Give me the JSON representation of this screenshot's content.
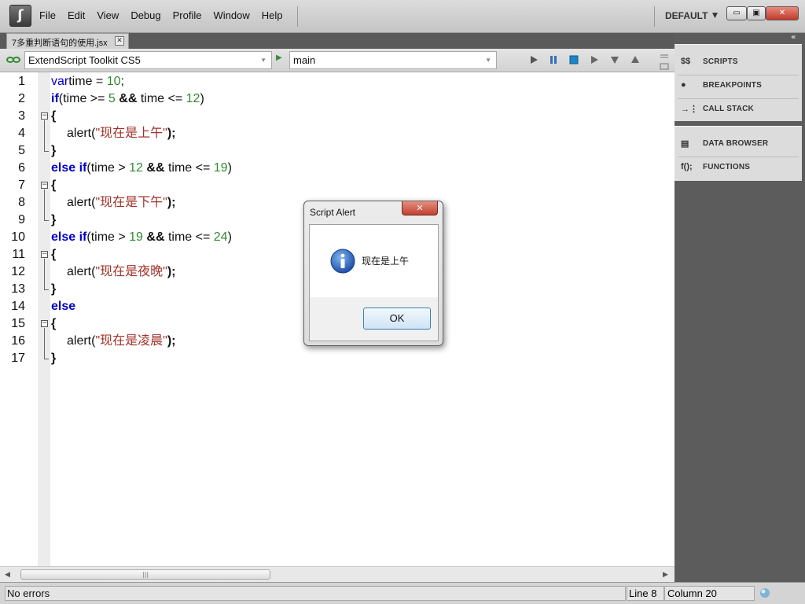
{
  "app": {
    "logo_icon": "extendscript-logo-icon",
    "menu": [
      "File",
      "Edit",
      "View",
      "Debug",
      "Profile",
      "Window",
      "Help"
    ],
    "workspace": "DEFAULT",
    "window_controls": {
      "minimize": "▭",
      "maximize": "▣",
      "close": "✕"
    }
  },
  "document_tab": {
    "label": "7多重判断语句的使用.jsx",
    "close": "✕"
  },
  "toolbar": {
    "target": "ExtendScript Toolkit CS5",
    "engine": "main",
    "debug_buttons": [
      "run",
      "pause",
      "stop",
      "step-over",
      "step-into",
      "step-out"
    ]
  },
  "editor": {
    "lines": [
      {
        "n": "1",
        "tokens": [
          [
            "kw",
            "var"
          ],
          [
            "",
            "time = "
          ],
          [
            "num",
            "10"
          ],
          [
            "",
            ";"
          ]
        ]
      },
      {
        "n": "2",
        "tokens": [
          [
            "kw bold",
            "if"
          ],
          [
            "",
            "(time >= "
          ],
          [
            "num",
            "5"
          ],
          [
            "bold",
            " && "
          ],
          [
            "",
            "time <= "
          ],
          [
            "num",
            "12"
          ],
          [
            "",
            ")"
          ]
        ]
      },
      {
        "n": "3",
        "tokens": [
          [
            "bold",
            "{"
          ]
        ]
      },
      {
        "n": "4",
        "indent": true,
        "tokens": [
          [
            "",
            "alert("
          ],
          [
            "str",
            "\"现在是上午\""
          ],
          [
            "bold",
            ");"
          ]
        ]
      },
      {
        "n": "5",
        "tokens": [
          [
            "bold",
            "}"
          ]
        ]
      },
      {
        "n": "6",
        "tokens": [
          [
            "kw bold",
            "else if"
          ],
          [
            "",
            "(time > "
          ],
          [
            "num",
            "12"
          ],
          [
            "bold",
            " && "
          ],
          [
            "",
            "time <= "
          ],
          [
            "num",
            "19"
          ],
          [
            "",
            ")"
          ]
        ]
      },
      {
        "n": "7",
        "tokens": [
          [
            "bold",
            "{"
          ]
        ]
      },
      {
        "n": "8",
        "indent": true,
        "tokens": [
          [
            "",
            "alert("
          ],
          [
            "str",
            "\"现在是下午\""
          ],
          [
            "bold",
            ");"
          ]
        ]
      },
      {
        "n": "9",
        "tokens": [
          [
            "bold",
            "}"
          ]
        ]
      },
      {
        "n": "10",
        "tokens": [
          [
            "kw bold",
            "else if"
          ],
          [
            "",
            "(time > "
          ],
          [
            "num",
            "19"
          ],
          [
            "bold",
            " && "
          ],
          [
            "",
            "time <= "
          ],
          [
            "num",
            "24"
          ],
          [
            "",
            ")"
          ]
        ]
      },
      {
        "n": "11",
        "tokens": [
          [
            "bold",
            "{"
          ]
        ]
      },
      {
        "n": "12",
        "indent": true,
        "tokens": [
          [
            "",
            "alert("
          ],
          [
            "str",
            "\"现在是夜晚\""
          ],
          [
            "bold",
            ");"
          ]
        ]
      },
      {
        "n": "13",
        "tokens": [
          [
            "bold",
            "}"
          ]
        ]
      },
      {
        "n": "14",
        "tokens": [
          [
            "kw bold",
            "else"
          ]
        ]
      },
      {
        "n": "15",
        "tokens": [
          [
            "bold",
            "{"
          ]
        ]
      },
      {
        "n": "16",
        "indent": true,
        "tokens": [
          [
            "",
            "alert("
          ],
          [
            "str",
            "\"现在是凌晨\""
          ],
          [
            "bold",
            ");"
          ]
        ]
      },
      {
        "n": "17",
        "tokens": [
          [
            "bold",
            "}"
          ]
        ]
      }
    ]
  },
  "status": {
    "message": "No errors",
    "line": "Line 8",
    "column": "Column 20"
  },
  "panels": {
    "group1": [
      {
        "icon": "$$",
        "label": "SCRIPTS"
      },
      {
        "icon": "●",
        "label": "BREAKPOINTS"
      },
      {
        "icon": "→⋮",
        "label": "CALL STACK"
      }
    ],
    "group2": [
      {
        "icon": "▤",
        "label": "DATA BROWSER"
      },
      {
        "icon": "f();",
        "label": "FUNCTIONS"
      }
    ]
  },
  "dialog": {
    "title": "Script Alert",
    "message": "现在是上午",
    "ok": "OK",
    "close": "✕",
    "icon": "info-icon"
  },
  "colors": {
    "keyword": "#0000c8",
    "number": "#2e8b2e",
    "string": "#a0322a"
  }
}
